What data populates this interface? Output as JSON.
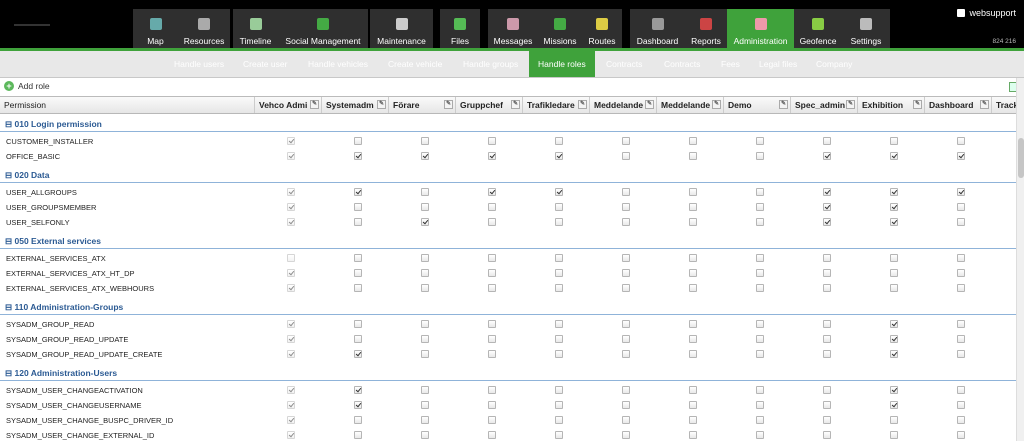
{
  "nav": {
    "groups": [
      {
        "items": [
          {
            "label": "Map",
            "icon": "map-icon"
          },
          {
            "label": "Resources",
            "icon": "resources-icon"
          }
        ]
      },
      {
        "items": [
          {
            "label": "Timeline",
            "icon": "timeline-icon"
          },
          {
            "label": "Social Management",
            "icon": "social-management-icon"
          }
        ]
      },
      {
        "items": [
          {
            "label": "Maintenance",
            "icon": "maintenance-icon"
          }
        ]
      },
      {
        "items": [
          {
            "label": "Files",
            "icon": "files-icon"
          }
        ]
      },
      {
        "items": [
          {
            "label": "Messages",
            "icon": "messages-icon"
          },
          {
            "label": "Missions",
            "icon": "missions-icon"
          },
          {
            "label": "Routes",
            "icon": "routes-icon"
          }
        ]
      },
      {
        "items": [
          {
            "label": "Dashboard",
            "icon": "dashboard-icon"
          },
          {
            "label": "Reports",
            "icon": "reports-icon"
          },
          {
            "label": "Administration",
            "icon": "administration-icon",
            "active": true
          },
          {
            "label": "Geofence",
            "icon": "geofence-icon"
          },
          {
            "label": "Settings",
            "icon": "settings-icon"
          }
        ]
      }
    ],
    "user": "websupport",
    "code": "824 216"
  },
  "subnav": [
    "Handle users",
    "Create user",
    "Handle vehicles",
    "Create vehicle",
    "Handle groups",
    "Handle roles",
    "Contracts",
    "Contracts",
    "Fees",
    "Legal files",
    "Company"
  ],
  "subnav_active": "Handle roles",
  "toolbar": {
    "add_role": "Add role"
  },
  "columns": [
    "Permission",
    "Vehco Admi",
    "Systemadm",
    "Förare",
    "Gruppchef",
    "Trafikledare",
    "Meddelande",
    "Meddelande",
    "Demo",
    "Spec_admin",
    "Exhibition",
    "Dashboard",
    "Tracki"
  ],
  "sections": [
    {
      "title": "010 Login permission",
      "rows": [
        {
          "name": "CUSTOMER_INSTALLER",
          "v": [
            1,
            0,
            0,
            0,
            0,
            0,
            0,
            0,
            0,
            0,
            0
          ]
        },
        {
          "name": "OFFICE_BASIC",
          "v": [
            1,
            1,
            1,
            1,
            1,
            0,
            0,
            0,
            1,
            1,
            1
          ]
        }
      ]
    },
    {
      "title": "020 Data",
      "rows": [
        {
          "name": "USER_ALLGROUPS",
          "v": [
            1,
            1,
            0,
            1,
            1,
            0,
            0,
            0,
            1,
            1,
            1
          ]
        },
        {
          "name": "USER_GROUPSMEMBER",
          "v": [
            1,
            0,
            0,
            0,
            0,
            0,
            0,
            0,
            1,
            1,
            0
          ]
        },
        {
          "name": "USER_SELFONLY",
          "v": [
            1,
            0,
            1,
            0,
            0,
            0,
            0,
            0,
            1,
            1,
            0
          ]
        }
      ]
    },
    {
      "title": "050 External services",
      "rows": [
        {
          "name": "EXTERNAL_SERVICES_ATX",
          "v": [
            0,
            0,
            0,
            0,
            0,
            0,
            0,
            0,
            0,
            0,
            0
          ]
        },
        {
          "name": "EXTERNAL_SERVICES_ATX_HT_DP",
          "v": [
            1,
            0,
            0,
            0,
            0,
            0,
            0,
            0,
            0,
            0,
            0
          ]
        },
        {
          "name": "EXTERNAL_SERVICES_ATX_WEBHOURS",
          "v": [
            1,
            0,
            0,
            0,
            0,
            0,
            0,
            0,
            0,
            0,
            0
          ]
        }
      ]
    },
    {
      "title": "110 Administration-Groups",
      "rows": [
        {
          "name": "SYSADM_GROUP_READ",
          "v": [
            1,
            0,
            0,
            0,
            0,
            0,
            0,
            0,
            0,
            1,
            0
          ]
        },
        {
          "name": "SYSADM_GROUP_READ_UPDATE",
          "v": [
            1,
            0,
            0,
            0,
            0,
            0,
            0,
            0,
            0,
            1,
            0
          ]
        },
        {
          "name": "SYSADM_GROUP_READ_UPDATE_CREATE",
          "v": [
            1,
            1,
            0,
            0,
            0,
            0,
            0,
            0,
            0,
            1,
            0
          ]
        }
      ]
    },
    {
      "title": "120 Administration-Users",
      "rows": [
        {
          "name": "SYSADM_USER_CHANGEACTIVATION",
          "v": [
            1,
            1,
            0,
            0,
            0,
            0,
            0,
            0,
            0,
            1,
            0
          ]
        },
        {
          "name": "SYSADM_USER_CHANGEUSERNAME",
          "v": [
            1,
            1,
            0,
            0,
            0,
            0,
            0,
            0,
            0,
            1,
            0
          ]
        },
        {
          "name": "SYSADM_USER_CHANGE_BUSPC_DRIVER_ID",
          "v": [
            1,
            0,
            0,
            0,
            0,
            0,
            0,
            0,
            0,
            0,
            0
          ]
        },
        {
          "name": "SYSADM_USER_CHANGE_EXTERNAL_ID",
          "v": [
            1,
            0,
            0,
            0,
            0,
            0,
            0,
            0,
            0,
            0,
            0
          ]
        }
      ]
    }
  ]
}
